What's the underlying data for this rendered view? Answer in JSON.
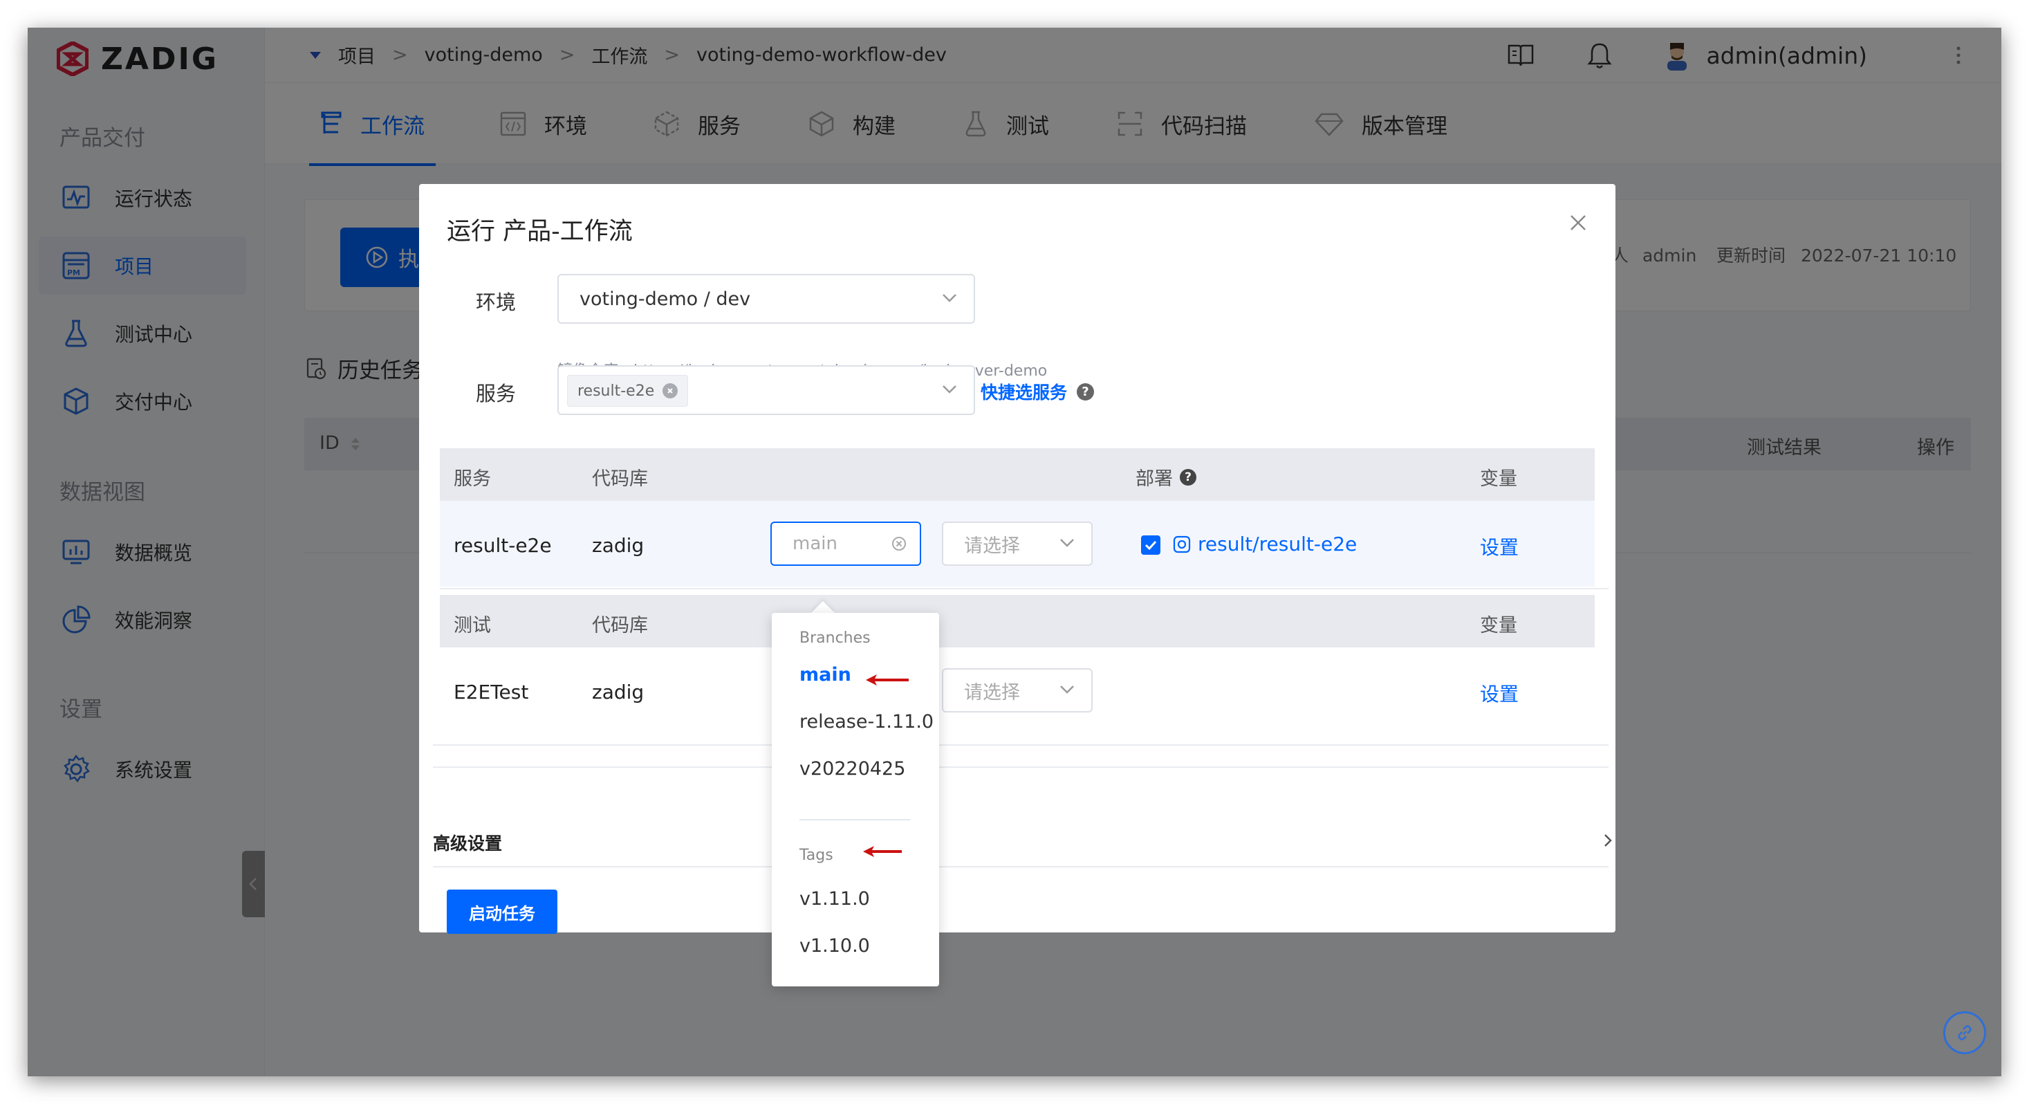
{
  "brand": {
    "name": "ZADIG",
    "color": "#d81e3c"
  },
  "sidebar": {
    "sections": [
      {
        "title": "产品交付",
        "items": [
          {
            "label": "运行状态",
            "icon": "activity-icon"
          },
          {
            "label": "项目",
            "icon": "project-pm-icon",
            "active": true
          },
          {
            "label": "测试中心",
            "icon": "flask-icon"
          },
          {
            "label": "交付中心",
            "icon": "package-icon"
          }
        ]
      },
      {
        "title": "数据视图",
        "items": [
          {
            "label": "数据概览",
            "icon": "monitor-chart-icon"
          },
          {
            "label": "效能洞察",
            "icon": "pie-chart-icon"
          }
        ]
      },
      {
        "title": "设置",
        "items": [
          {
            "label": "系统设置",
            "icon": "gear-icon"
          }
        ]
      }
    ]
  },
  "topbar": {
    "breadcrumb": [
      "项目",
      "voting-demo",
      "工作流",
      "voting-demo-workflow-dev"
    ],
    "separator": ">",
    "user": "admin(admin)"
  },
  "tabs": [
    {
      "label": "工作流",
      "icon": "workflow-icon",
      "active": true
    },
    {
      "label": "环境",
      "icon": "code-env-icon"
    },
    {
      "label": "服务",
      "icon": "cube-icon"
    },
    {
      "label": "构建",
      "icon": "box-icon"
    },
    {
      "label": "测试",
      "icon": "flask-icon"
    },
    {
      "label": "代码扫描",
      "icon": "scan-icon"
    },
    {
      "label": "版本管理",
      "icon": "diamond-icon"
    }
  ],
  "background_page": {
    "run_button": "执",
    "owner_fragment": "人",
    "owner": "admin",
    "updated_label": "更新时间",
    "updated_value": "2022-07-21 10:10",
    "history_title": "历史任务",
    "table_headers": {
      "id": "ID",
      "test_result": "测试结果",
      "action": "操作"
    }
  },
  "modal": {
    "title": "运行 产品-工作流",
    "env_label": "环境",
    "env_value": "voting-demo / dev",
    "registry_hint": "镜像仓库：https://koderover.tencentcloudcr.com/koderover-demo",
    "service_label": "服务",
    "service_tag": "result-e2e",
    "quick_select": "快捷选服务",
    "service_table": {
      "headers": {
        "service": "服务",
        "repo": "代码库",
        "deploy": "部署",
        "vars": "变量"
      },
      "row": {
        "service": "result-e2e",
        "repo": "zadig",
        "branch_placeholder": "main",
        "select_placeholder": "请选择",
        "deploy_target": "result/result-e2e",
        "deploy_checked": true,
        "settings": "设置"
      }
    },
    "test_table": {
      "headers": {
        "test": "测试",
        "repo": "代码库",
        "vars": "变量"
      },
      "row": {
        "test": "E2ETest",
        "repo": "zadig",
        "select_placeholder": "请选择",
        "settings": "设置"
      }
    },
    "advanced": "高级设置",
    "start_button": "启动任务"
  },
  "dropdown": {
    "branches_title": "Branches",
    "branches": [
      "main",
      "release-1.11.0",
      "v20220425"
    ],
    "selected": "main",
    "tags_title": "Tags",
    "tags": [
      "v1.11.0",
      "v1.10.0"
    ]
  },
  "colors": {
    "accent": "#0066ff",
    "arrow": "#cc1111",
    "overlay": "rgba(0,0,0,0.5)"
  }
}
